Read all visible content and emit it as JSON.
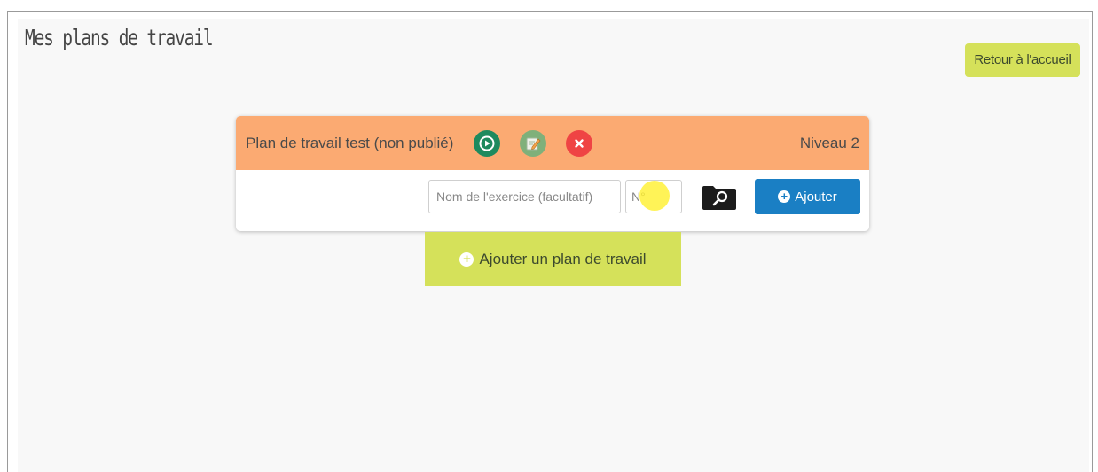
{
  "page": {
    "title": "Mes plans de travail"
  },
  "header": {
    "home_button_label": "Retour à l'accueil"
  },
  "plan": {
    "title": "Plan de travail test (non publié)",
    "level": "Niveau 2",
    "actions": {
      "play_icon": "play-circle-icon",
      "edit_icon": "edit-icon",
      "delete_icon": "close-circle-icon"
    },
    "exercise_form": {
      "name_placeholder": "Nom de l'exercice (facultatif)",
      "name_value": "",
      "number_placeholder": "N°",
      "number_value": "",
      "browse_icon": "folder-search-icon",
      "add_label": "Ajouter"
    }
  },
  "add_plan_button_label": "Ajouter un plan de travail",
  "colors": {
    "plan_header": "#fbaa72",
    "lime": "#d5e15a",
    "primary_blue": "#1a7fc4",
    "play_green": "#1e8a5e",
    "edit_green": "#7fb07a",
    "delete_red": "#ef4444"
  }
}
